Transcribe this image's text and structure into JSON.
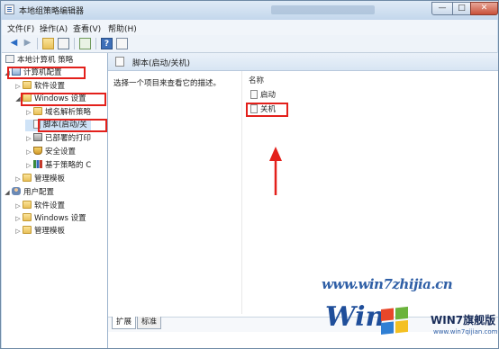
{
  "window": {
    "title": "本地组策略编辑器",
    "caption_buttons": {
      "minimize": "—",
      "maximize": "□",
      "close": "✕"
    }
  },
  "menu": [
    "文件(F)",
    "操作(A)",
    "查看(V)",
    "帮助(H)"
  ],
  "toolbar": {
    "icons": [
      "back-arrow-icon",
      "forward-arrow-icon",
      "up-folder-icon",
      "show-tree-icon",
      "export-list-icon",
      "help-icon",
      "properties-icon"
    ]
  },
  "tree": {
    "root": "本地计算机 策略",
    "computer_config": "计算机配置",
    "software_settings": "软件设置",
    "windows_settings": "Windows 设置",
    "dns_policy": "域名解析策略",
    "scripts": "脚本(启动/关",
    "deployed_printers": "已部署的打印",
    "security_settings": "安全设置",
    "qos_policy": "基于策略的 C",
    "admin_templates": "管理模板",
    "user_config": "用户配置",
    "user_software_settings": "软件设置",
    "user_windows_settings": "Windows 设置",
    "user_admin_templates": "管理模板"
  },
  "content": {
    "header": "脚本(启动/关机)",
    "description": "选择一个项目来查看它的描述。",
    "column_name": "名称",
    "items": [
      "启动",
      "关机"
    ]
  },
  "tabs": [
    "扩展",
    "标准"
  ],
  "watermark": {
    "site": "www.win7zhijia.cn",
    "logo_text": "Win",
    "brand": "WIN7旗舰版",
    "sub": "www.win7qijian.com"
  },
  "colors": {
    "annotation_red": "#e3201b",
    "title_bar": "#c3d7ec",
    "selection": "#cfe3f7"
  }
}
